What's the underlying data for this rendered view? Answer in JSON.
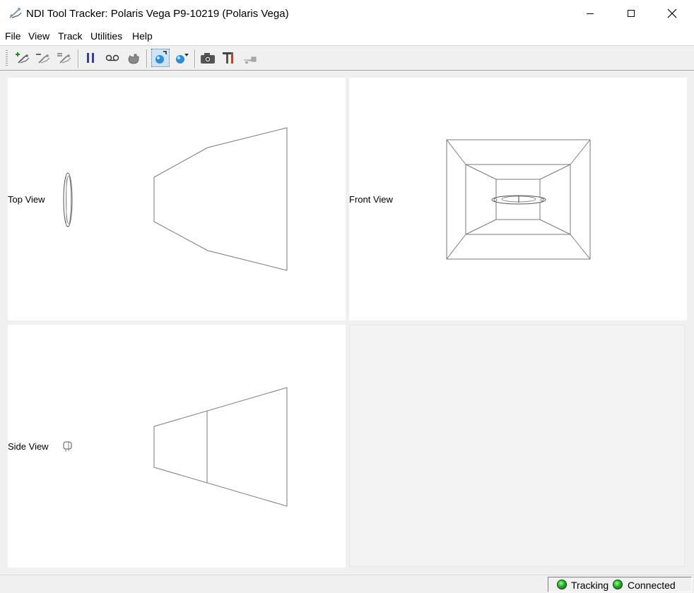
{
  "window": {
    "title": "NDI Tool Tracker: Polaris Vega P9-10219 (Polaris Vega)",
    "icon": "tool-tracker-icon"
  },
  "menu": {
    "items": [
      "File",
      "View",
      "Track",
      "Utilities",
      "Help"
    ]
  },
  "toolbar": {
    "buttons": [
      {
        "icon": "add-tool-icon"
      },
      {
        "icon": "remove-tool-icon"
      },
      {
        "icon": "tool-properties-icon"
      },
      {
        "icon": "pause-icon"
      },
      {
        "icon": "record-icon"
      },
      {
        "icon": "hand-icon"
      },
      {
        "icon": "view-mode-icon",
        "selected": true
      },
      {
        "icon": "view-dropdown-icon"
      },
      {
        "icon": "camera-icon"
      },
      {
        "icon": "utilities-icon"
      },
      {
        "icon": "tool-disabled-icon"
      }
    ]
  },
  "views": {
    "top": {
      "label": "Top View"
    },
    "front": {
      "label": "Front View"
    },
    "side": {
      "label": "Side View"
    }
  },
  "status": {
    "tracking_label": "Tracking",
    "connected_label": "Connected",
    "indicator_color": "#22b322"
  }
}
